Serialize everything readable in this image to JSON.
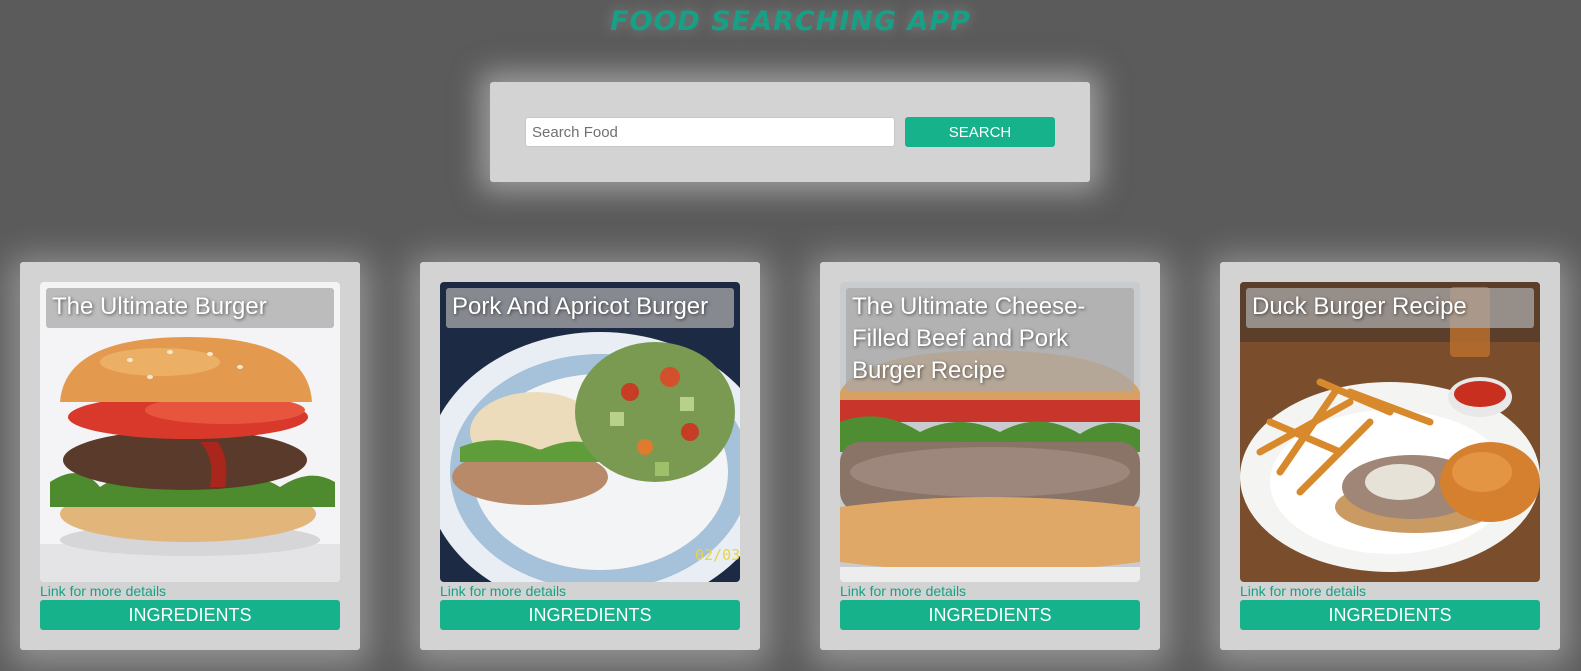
{
  "app": {
    "title": "FOOD SEARCHING APP"
  },
  "search": {
    "placeholder": "Search Food",
    "value": "",
    "button_label": "SEARCH"
  },
  "theme": {
    "accent": "#16b28c",
    "background": "#5b5b5b",
    "panel": "#d3d3d3"
  },
  "cards": [
    {
      "title": "The Ultimate Burger",
      "link_label": "Link for more details",
      "button_label": "INGREDIENTS",
      "image": "burger-photo"
    },
    {
      "title": "Pork And Apricot Burger",
      "link_label": "Link for more details",
      "button_label": "INGREDIENTS",
      "image": "plate-photo",
      "image_stamp": "02/03"
    },
    {
      "title": "The Ultimate Cheese-Filled Beef and Pork Burger Recipe",
      "link_label": "Link for more details",
      "button_label": "INGREDIENTS",
      "image": "burger-photo"
    },
    {
      "title": "Duck Burger Recipe",
      "link_label": "Link for more details",
      "button_label": "INGREDIENTS",
      "image": "plate-photo"
    }
  ]
}
